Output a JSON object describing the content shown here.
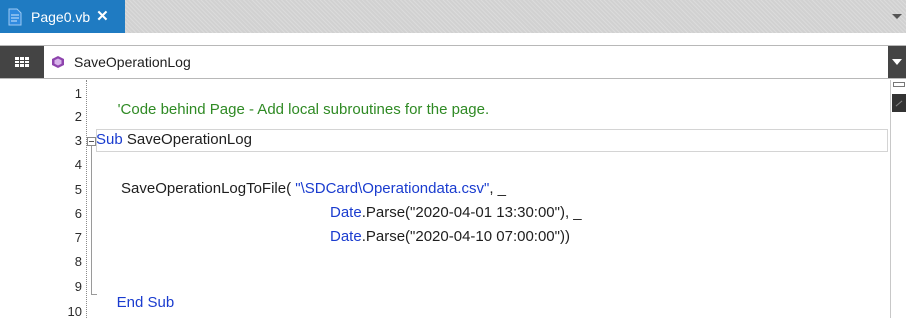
{
  "tab": {
    "label": "Page0.vb",
    "close": "✕"
  },
  "nav": {
    "member": "SaveOperationLog"
  },
  "lines": {
    "numbers": [
      "1",
      "2",
      "3",
      "4",
      "5",
      "6",
      "7",
      "8",
      "9",
      "10"
    ],
    "l1_comment": "'Code behind Page - Add local subroutines for the page.",
    "l3_kw": "Sub",
    "l3_name": " SaveOperationLog",
    "l5_call": "SaveOperationLogToFile( ",
    "l5_str": "\"\\SDCard\\Operationdata.csv\"",
    "l5_tail": ", _",
    "l6_type": "Date",
    "l6_call": ".Parse(\"2020-04-01 13:30:00\"), _",
    "l7_type": "Date",
    "l7_call": ".Parse(\"2020-04-10 07:00:00\"))",
    "l9_kw": "End Sub"
  },
  "colors": {
    "keyword": "#1a3ccf",
    "comment": "#2f8a24",
    "tab_active": "#1f7bc2"
  }
}
